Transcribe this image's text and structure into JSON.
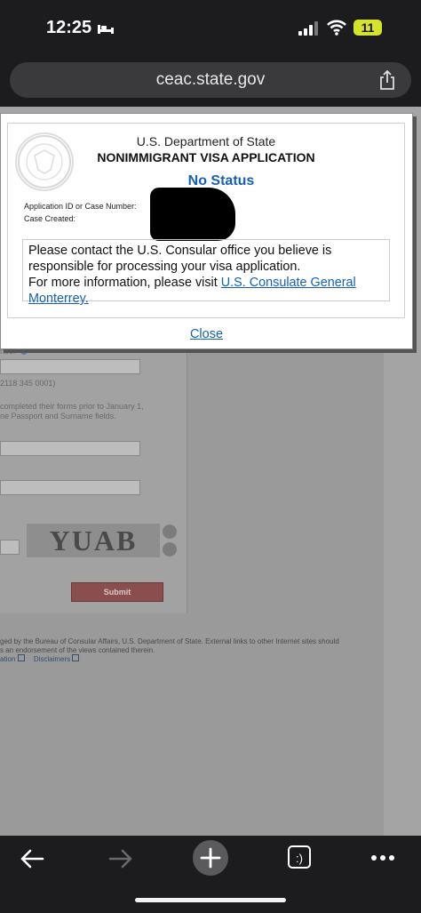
{
  "status_bar": {
    "time": "12:25",
    "battery": "11"
  },
  "browser": {
    "url": "ceac.state.gov"
  },
  "background_page": {
    "field_label_fragment": "nber",
    "field_hint": "2118 345 0001)",
    "notice_line1": "completed their forms prior to January 1,",
    "notice_line2": "ne Passport and Surname fields.",
    "captcha_text": "YUAB",
    "submit_label": "Submit",
    "footer_line1": "ged by the Bureau of Consular Affairs, U.S. Department of State. External links to other Internet sites should",
    "footer_line2": "s an endorsement of the views contained therein.",
    "footer_link1": "ation",
    "footer_link2": "Disclaimers"
  },
  "modal": {
    "department": "U.S. Department of State",
    "title": "NONIMMIGRANT VISA APPLICATION",
    "status": "No Status",
    "app_id_label": "Application ID or Case Number:",
    "case_created_label": "Case Created:",
    "message_text": "Please contact the U.S. Consular office you believe is responsible for processing your visa application.",
    "more_info_text": "For more information, please visit ",
    "consulate_link": "U.S. Consulate General Monterrey.",
    "close_label": "Close"
  },
  "toolbar": {
    "tabs_label": ":)"
  },
  "colors": {
    "link_blue": "#1560b5",
    "battery_yellow": "#d6e32b"
  }
}
